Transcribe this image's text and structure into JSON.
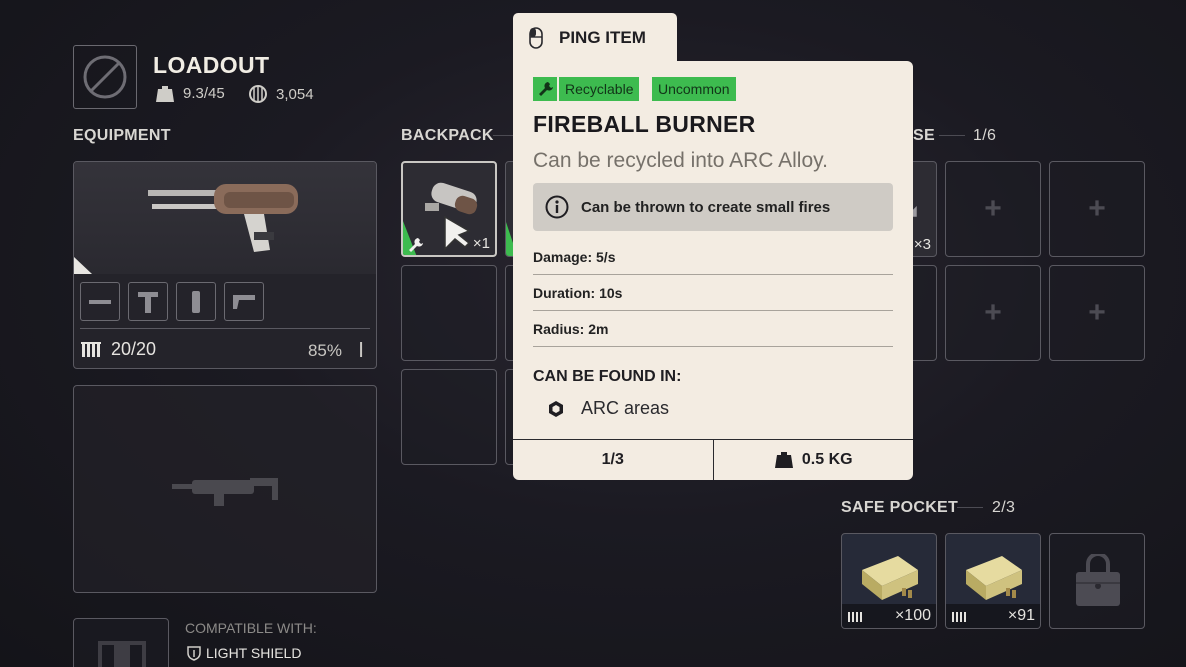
{
  "loadout": {
    "title": "LOADOUT",
    "weight": "9.3/45",
    "currency": "3,054"
  },
  "equipment": {
    "label": "EQUIPMENT",
    "primary": {
      "ammo": "20/20",
      "durability": "85%",
      "attachments": [
        "muzzle-attachment-icon",
        "underbarrel-attachment-icon",
        "magazine-attachment-icon",
        "stock-attachment-icon"
      ]
    },
    "shield": {
      "compatible_label": "COMPATIBLE WITH:",
      "compatible_value": "LIGHT SHIELD"
    }
  },
  "backpack": {
    "label": "BACKPACK",
    "first_item_count": "×1"
  },
  "quick_use": {
    "label_partial": "SE",
    "capacity": "1/6",
    "first_item_count": "×3"
  },
  "safe_pocket": {
    "label": "SAFE POCKET",
    "capacity": "2/3",
    "items": [
      {
        "count": "×100"
      },
      {
        "count": "×91"
      }
    ]
  },
  "tooltip": {
    "ping_label": "PING ITEM",
    "tags": [
      "Recyclable",
      "Uncommon"
    ],
    "name": "FIREBALL BURNER",
    "recycle_text": "Can be recycled into ARC Alloy.",
    "info_text": "Can be thrown to create small fires",
    "stats": [
      {
        "text": "Damage: 5/s"
      },
      {
        "text": "Duration: 10s"
      },
      {
        "text": "Radius: 2m"
      }
    ],
    "found_label": "CAN BE FOUND IN:",
    "found_location": "ARC areas",
    "stack": "1/3",
    "weight": "0.5 KG",
    "colors": {
      "background": "#f3ece2",
      "tag_green": "#3dbb4f"
    }
  }
}
